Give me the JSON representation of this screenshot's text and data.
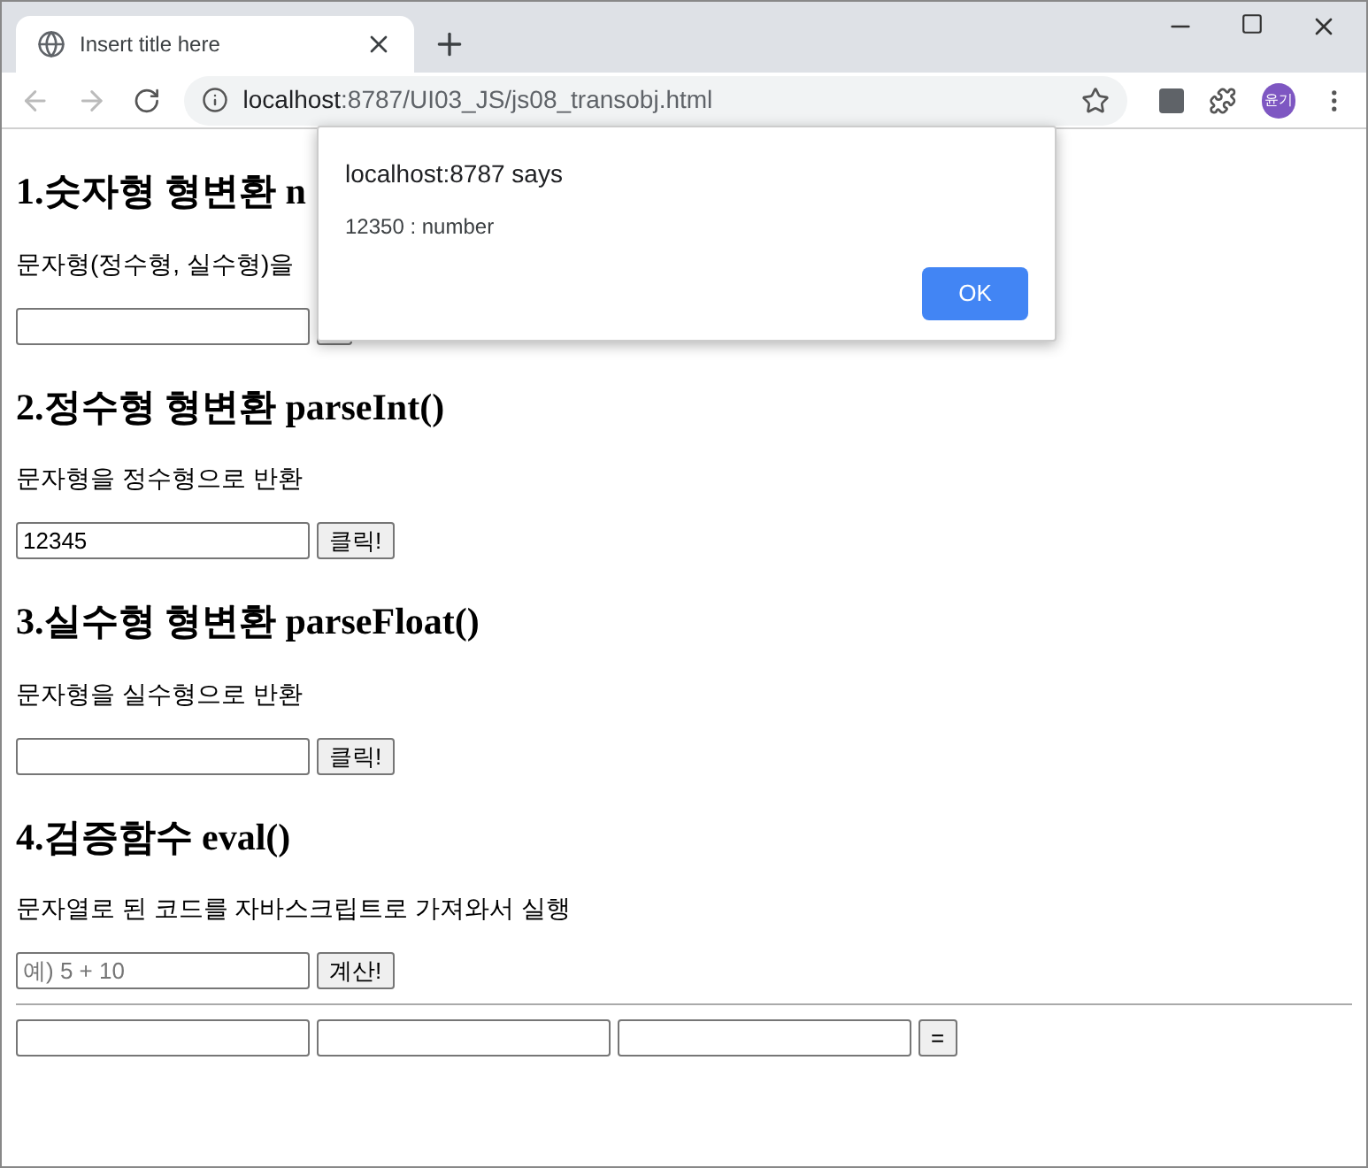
{
  "tab": {
    "title": "Insert title here"
  },
  "address_bar": {
    "host": "localhost",
    "rest": ":8787/UI03_JS/js08_transobj.html"
  },
  "profile": {
    "initials": "윤기"
  },
  "sections": [
    {
      "heading": "1.숫자형 형변환 n",
      "description": "문자형(정수형, 실수형)을"
    },
    {
      "heading": "2.정수형 형변환 parseInt()",
      "description": "문자형을 정수형으로 반환",
      "value": "12345",
      "button": "클릭!"
    },
    {
      "heading": "3.실수형 형변환 parseFloat()",
      "description": "문자형을 실수형으로 반환",
      "button": "클릭!"
    },
    {
      "heading": "4.검증함수 eval()",
      "description": "문자열로 된 코드를 자바스크립트로 가져와서 실행",
      "placeholder": "예) 5 + 10",
      "button": "계산!"
    }
  ],
  "calc_row": {
    "button": "="
  },
  "dialog": {
    "title": "localhost:8787 says",
    "message": "12350 : number",
    "button": "OK"
  }
}
